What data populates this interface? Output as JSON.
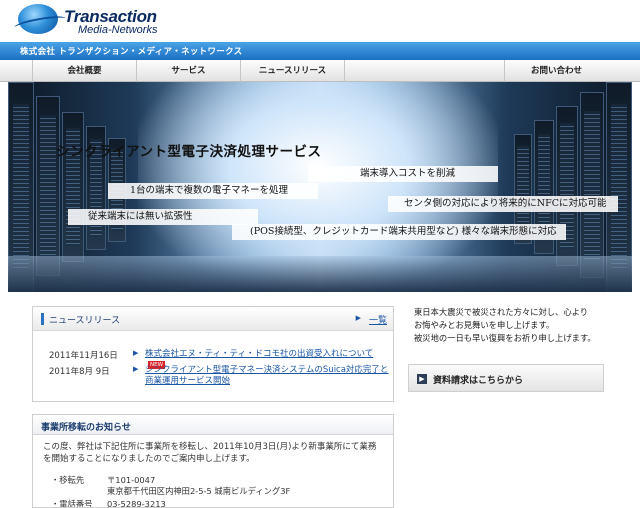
{
  "header": {
    "logo_line1": "Transaction",
    "logo_line2": "Media-Networks",
    "company_name": "株式会社 トランザクション・メディア・ネットワークス"
  },
  "nav": {
    "items": [
      {
        "label": "会社概要"
      },
      {
        "label": "サービス"
      },
      {
        "label": "ニュースリリース"
      },
      {
        "label": ""
      },
      {
        "label": "お問い合わせ"
      }
    ]
  },
  "hero": {
    "title": "シンクライアント型電子決済処理サービス",
    "bands": [
      "端末導入コストを削減",
      "1台の端末で複数の電子マネーを処理",
      "センタ側の対応により将来的にNFCに対応可能",
      "従来端末には無い拡張性",
      "(POS接続型、クレジットカード端末共用型など) 様々な端末形態に対応"
    ]
  },
  "news": {
    "title": "ニュースリリース",
    "more_label": "一覧",
    "items": [
      {
        "date": "2011年11月16日",
        "text": "株式会社エヌ・ティ・ティ・ドコモ社の出資受入れについて",
        "badge": "NEW"
      },
      {
        "date": "2011年8月 9日",
        "text": "シンクライアント型電子マネー決済システムのSuica対応完了と商業運用サービス開始",
        "badge": ""
      }
    ]
  },
  "notice": {
    "lines": [
      "東日本大震災で被災された方々に対し、心より",
      "お悔やみとお見舞いを申し上げます。",
      "被災地の一日も早い復興をお祈り申し上げます。"
    ]
  },
  "request": {
    "label": "資料請求はこちらから",
    "icon": "document-icon"
  },
  "office_move": {
    "title": "事業所移転のお知らせ",
    "text": "この度、弊社は下記住所に事業所を移転し、2011年10月3日(月)より新事業所にて業務を開始することになりましたのでご案内申し上げます。",
    "rows": [
      {
        "key": "・移転先",
        "value": "〒101-0047"
      },
      {
        "key": "",
        "value": "東京都千代田区内神田2-5-5 城南ビルディング3F"
      },
      {
        "key": "・電話番号",
        "value": "03-5289-3213"
      }
    ]
  }
}
